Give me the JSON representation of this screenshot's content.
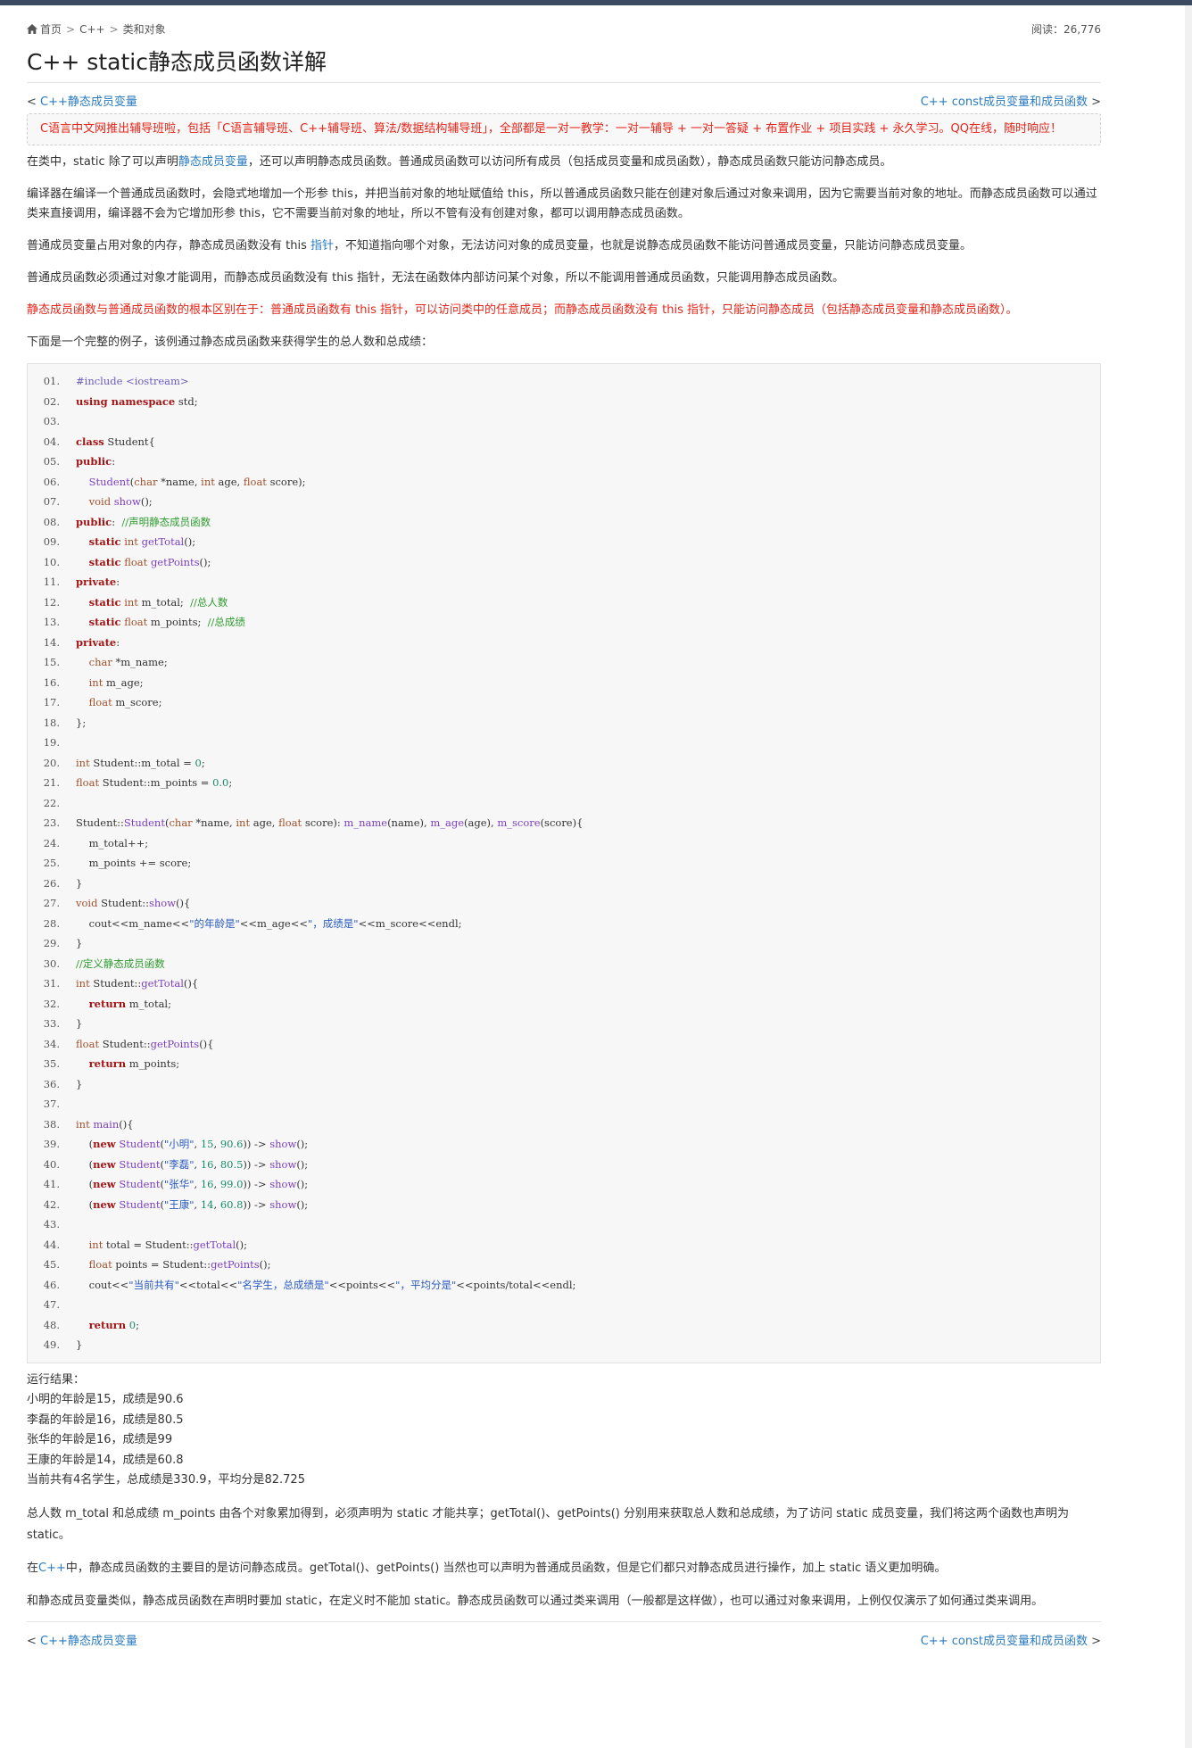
{
  "breadcrumb": [
    "首页",
    "C++",
    "类和对象"
  ],
  "views_label": "阅读：26,776",
  "title": "C++ static静态成员函数详解",
  "nav": {
    "prev_arrow": "<",
    "prev_label": "C++静态成员变量",
    "next_label": "C++ const成员变量和成员函数",
    "next_arrow": ">"
  },
  "notice": "C语言中文网推出辅导班啦，包括「C语言辅导班、C++辅导班、算法/数据结构辅导班」，全部都是一对一教学：一对一辅导 + 一对一答疑 + 布置作业 + 项目实践 + 永久学习。QQ在线，随时响应！",
  "paragraphs": {
    "p1_pre": "在类中，static 除了可以声明",
    "p1_link": "静态成员变量",
    "p1_post": "，还可以声明静态成员函数。普通成员函数可以访问所有成员（包括成员变量和成员函数），静态成员函数只能访问静态成员。",
    "p2": "编译器在编译一个普通成员函数时，会隐式地增加一个形参 this，并把当前对象的地址赋值给 this，所以普通成员函数只能在创建对象后通过对象来调用，因为它需要当前对象的地址。而静态成员函数可以通过类来直接调用，编译器不会为它增加形参 this，它不需要当前对象的地址，所以不管有没有创建对象，都可以调用静态成员函数。",
    "p3_pre": "普通成员变量占用对象的内存，静态成员函数没有 this ",
    "p3_link": "指针",
    "p3_post": "，不知道指向哪个对象，无法访问对象的成员变量，也就是说静态成员函数不能访问普通成员变量，只能访问静态成员变量。",
    "p4": "普通成员函数必须通过对象才能调用，而静态成员函数没有 this 指针，无法在函数体内部访问某个对象，所以不能调用普通成员函数，只能调用静态成员函数。",
    "p5": "静态成员函数与普通成员函数的根本区别在于：普通成员函数有 this 指针，可以访问类中的任意成员；而静态成员函数没有 this 指针，只能访问静态成员（包括静态成员变量和静态成员函数）。",
    "p6": "下面是一个完整的例子，该例通过静态成员函数来获得学生的总人数和总成绩："
  },
  "code_lines": [
    [
      [
        "pp",
        "#include <iostream>"
      ]
    ],
    [
      [
        "kw",
        "using namespace"
      ],
      [
        "pl",
        " std;"
      ]
    ],
    [],
    [
      [
        "kw",
        "class"
      ],
      [
        "pl",
        " Student{"
      ]
    ],
    [
      [
        "kw",
        "public"
      ],
      [
        "pl",
        ":"
      ]
    ],
    [
      [
        "pl",
        "    "
      ],
      [
        "fn",
        "Student"
      ],
      [
        "pl",
        "("
      ],
      [
        "ty",
        "char"
      ],
      [
        "pl",
        " *name, "
      ],
      [
        "ty",
        "int"
      ],
      [
        "pl",
        " age, "
      ],
      [
        "ty",
        "float"
      ],
      [
        "pl",
        " score);"
      ]
    ],
    [
      [
        "pl",
        "    "
      ],
      [
        "ty",
        "void"
      ],
      [
        "pl",
        " "
      ],
      [
        "fn",
        "show"
      ],
      [
        "pl",
        "();"
      ]
    ],
    [
      [
        "kw",
        "public"
      ],
      [
        "pl",
        ":  "
      ],
      [
        "cm",
        "//声明静态成员函数"
      ]
    ],
    [
      [
        "pl",
        "    "
      ],
      [
        "kw",
        "static"
      ],
      [
        "pl",
        " "
      ],
      [
        "ty",
        "int"
      ],
      [
        "pl",
        " "
      ],
      [
        "fn",
        "getTotal"
      ],
      [
        "pl",
        "();"
      ]
    ],
    [
      [
        "pl",
        "    "
      ],
      [
        "kw",
        "static"
      ],
      [
        "pl",
        " "
      ],
      [
        "ty",
        "float"
      ],
      [
        "pl",
        " "
      ],
      [
        "fn",
        "getPoints"
      ],
      [
        "pl",
        "();"
      ]
    ],
    [
      [
        "kw",
        "private"
      ],
      [
        "pl",
        ":"
      ]
    ],
    [
      [
        "pl",
        "    "
      ],
      [
        "kw",
        "static"
      ],
      [
        "pl",
        " "
      ],
      [
        "ty",
        "int"
      ],
      [
        "pl",
        " m_total;  "
      ],
      [
        "cm",
        "//总人数"
      ]
    ],
    [
      [
        "pl",
        "    "
      ],
      [
        "kw",
        "static"
      ],
      [
        "pl",
        " "
      ],
      [
        "ty",
        "float"
      ],
      [
        "pl",
        " m_points;  "
      ],
      [
        "cm",
        "//总成绩"
      ]
    ],
    [
      [
        "kw",
        "private"
      ],
      [
        "pl",
        ":"
      ]
    ],
    [
      [
        "pl",
        "    "
      ],
      [
        "ty",
        "char"
      ],
      [
        "pl",
        " *m_name;"
      ]
    ],
    [
      [
        "pl",
        "    "
      ],
      [
        "ty",
        "int"
      ],
      [
        "pl",
        " m_age;"
      ]
    ],
    [
      [
        "pl",
        "    "
      ],
      [
        "ty",
        "float"
      ],
      [
        "pl",
        " m_score;"
      ]
    ],
    [
      [
        "pl",
        "};"
      ]
    ],
    [],
    [
      [
        "ty",
        "int"
      ],
      [
        "pl",
        " Student::m_total = "
      ],
      [
        "nm",
        "0"
      ],
      [
        "pl",
        ";"
      ]
    ],
    [
      [
        "ty",
        "float"
      ],
      [
        "pl",
        " Student::m_points = "
      ],
      [
        "nm",
        "0.0"
      ],
      [
        "pl",
        ";"
      ]
    ],
    [],
    [
      [
        "pl",
        "Student::"
      ],
      [
        "fn",
        "Student"
      ],
      [
        "pl",
        "("
      ],
      [
        "ty",
        "char"
      ],
      [
        "pl",
        " *name, "
      ],
      [
        "ty",
        "int"
      ],
      [
        "pl",
        " age, "
      ],
      [
        "ty",
        "float"
      ],
      [
        "pl",
        " score): "
      ],
      [
        "fn",
        "m_name"
      ],
      [
        "pl",
        "(name), "
      ],
      [
        "fn",
        "m_age"
      ],
      [
        "pl",
        "(age), "
      ],
      [
        "fn",
        "m_score"
      ],
      [
        "pl",
        "(score){"
      ]
    ],
    [
      [
        "pl",
        "    m_total++;"
      ]
    ],
    [
      [
        "pl",
        "    m_points += score;"
      ]
    ],
    [
      [
        "pl",
        "}"
      ]
    ],
    [
      [
        "ty",
        "void"
      ],
      [
        "pl",
        " Student::"
      ],
      [
        "fn",
        "show"
      ],
      [
        "pl",
        "(){"
      ]
    ],
    [
      [
        "pl",
        "    cout<<m_name<<"
      ],
      [
        "st",
        "\"的年龄是\""
      ],
      [
        "pl",
        "<<m_age<<"
      ],
      [
        "st",
        "\"，成绩是\""
      ],
      [
        "pl",
        "<<m_score<<endl;"
      ]
    ],
    [
      [
        "pl",
        "}"
      ]
    ],
    [
      [
        "cm",
        "//定义静态成员函数"
      ]
    ],
    [
      [
        "ty",
        "int"
      ],
      [
        "pl",
        " Student::"
      ],
      [
        "fn",
        "getTotal"
      ],
      [
        "pl",
        "(){"
      ]
    ],
    [
      [
        "pl",
        "    "
      ],
      [
        "kw",
        "return"
      ],
      [
        "pl",
        " m_total;"
      ]
    ],
    [
      [
        "pl",
        "}"
      ]
    ],
    [
      [
        "ty",
        "float"
      ],
      [
        "pl",
        " Student::"
      ],
      [
        "fn",
        "getPoints"
      ],
      [
        "pl",
        "(){"
      ]
    ],
    [
      [
        "pl",
        "    "
      ],
      [
        "kw",
        "return"
      ],
      [
        "pl",
        " m_points;"
      ]
    ],
    [
      [
        "pl",
        "}"
      ]
    ],
    [],
    [
      [
        "ty",
        "int"
      ],
      [
        "pl",
        " "
      ],
      [
        "fn",
        "main"
      ],
      [
        "pl",
        "(){"
      ]
    ],
    [
      [
        "pl",
        "    ("
      ],
      [
        "kw",
        "new"
      ],
      [
        "pl",
        " "
      ],
      [
        "fn",
        "Student"
      ],
      [
        "pl",
        "("
      ],
      [
        "st",
        "\"小明\""
      ],
      [
        "pl",
        ", "
      ],
      [
        "nm",
        "15"
      ],
      [
        "pl",
        ", "
      ],
      [
        "nm",
        "90.6"
      ],
      [
        "pl",
        ")) -> "
      ],
      [
        "fn",
        "show"
      ],
      [
        "pl",
        "();"
      ]
    ],
    [
      [
        "pl",
        "    ("
      ],
      [
        "kw",
        "new"
      ],
      [
        "pl",
        " "
      ],
      [
        "fn",
        "Student"
      ],
      [
        "pl",
        "("
      ],
      [
        "st",
        "\"李磊\""
      ],
      [
        "pl",
        ", "
      ],
      [
        "nm",
        "16"
      ],
      [
        "pl",
        ", "
      ],
      [
        "nm",
        "80.5"
      ],
      [
        "pl",
        ")) -> "
      ],
      [
        "fn",
        "show"
      ],
      [
        "pl",
        "();"
      ]
    ],
    [
      [
        "pl",
        "    ("
      ],
      [
        "kw",
        "new"
      ],
      [
        "pl",
        " "
      ],
      [
        "fn",
        "Student"
      ],
      [
        "pl",
        "("
      ],
      [
        "st",
        "\"张华\""
      ],
      [
        "pl",
        ", "
      ],
      [
        "nm",
        "16"
      ],
      [
        "pl",
        ", "
      ],
      [
        "nm",
        "99.0"
      ],
      [
        "pl",
        ")) -> "
      ],
      [
        "fn",
        "show"
      ],
      [
        "pl",
        "();"
      ]
    ],
    [
      [
        "pl",
        "    ("
      ],
      [
        "kw",
        "new"
      ],
      [
        "pl",
        " "
      ],
      [
        "fn",
        "Student"
      ],
      [
        "pl",
        "("
      ],
      [
        "st",
        "\"王康\""
      ],
      [
        "pl",
        ", "
      ],
      [
        "nm",
        "14"
      ],
      [
        "pl",
        ", "
      ],
      [
        "nm",
        "60.8"
      ],
      [
        "pl",
        ")) -> "
      ],
      [
        "fn",
        "show"
      ],
      [
        "pl",
        "();"
      ]
    ],
    [],
    [
      [
        "pl",
        "    "
      ],
      [
        "ty",
        "int"
      ],
      [
        "pl",
        " total = Student::"
      ],
      [
        "fn",
        "getTotal"
      ],
      [
        "pl",
        "();"
      ]
    ],
    [
      [
        "pl",
        "    "
      ],
      [
        "ty",
        "float"
      ],
      [
        "pl",
        " points = Student::"
      ],
      [
        "fn",
        "getPoints"
      ],
      [
        "pl",
        "();"
      ]
    ],
    [
      [
        "pl",
        "    cout<<"
      ],
      [
        "st",
        "\"当前共有\""
      ],
      [
        "pl",
        "<<total<<"
      ],
      [
        "st",
        "\"名学生，总成绩是\""
      ],
      [
        "pl",
        "<<points<<"
      ],
      [
        "st",
        "\"，平均分是\""
      ],
      [
        "pl",
        "<<points/total<<endl;"
      ]
    ],
    [],
    [
      [
        "pl",
        "    "
      ],
      [
        "kw",
        "return"
      ],
      [
        "pl",
        " "
      ],
      [
        "nm",
        "0"
      ],
      [
        "pl",
        ";"
      ]
    ],
    [
      [
        "pl",
        "}"
      ]
    ]
  ],
  "result_label": "运行结果：",
  "result_lines": [
    "小明的年龄是15，成绩是90.6",
    "李磊的年龄是16，成绩是80.5",
    "张华的年龄是16，成绩是99",
    "王康的年龄是14，成绩是60.8",
    "当前共有4名学生，总成绩是330.9，平均分是82.725"
  ],
  "after": {
    "a1": "总人数 m_total 和总成绩 m_points 由各个对象累加得到，必须声明为 static 才能共享；getTotal()、getPoints() 分别用来获取总人数和总成绩，为了访问 static 成员变量，我们将这两个函数也声明为 static。",
    "a2_pre": "在",
    "a2_link": "C++",
    "a2_post": "中，静态成员函数的主要目的是访问静态成员。getTotal()、getPoints() 当然也可以声明为普通成员函数，但是它们都只对静态成员进行操作，加上 static 语义更加明确。",
    "a3": "和静态成员变量类似，静态成员函数在声明时要加 static，在定义时不能加 static。静态成员函数可以通过类来调用（一般都是这样做），也可以通过对象来调用，上例仅仅演示了如何通过类来调用。"
  }
}
